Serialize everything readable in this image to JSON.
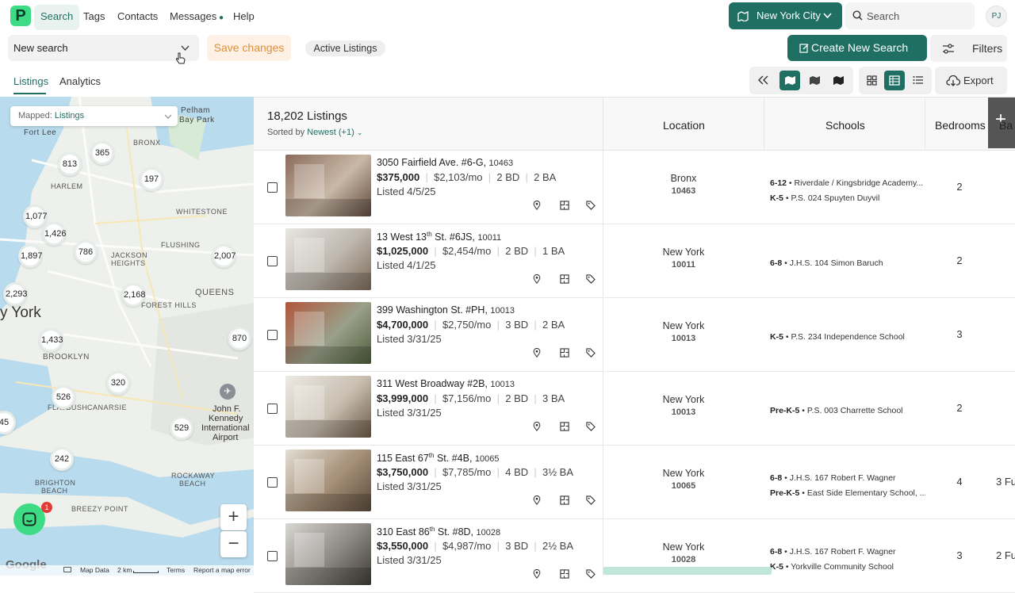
{
  "nav": {
    "logo": "P",
    "items": [
      {
        "label": "Search"
      },
      {
        "label": "Tags"
      },
      {
        "label": "Contacts"
      },
      {
        "label": "Messages"
      },
      {
        "label": "Help"
      }
    ],
    "city": "New York City",
    "search_placeholder": "Search",
    "avatar": "PJ"
  },
  "toolbar": {
    "new_search": "New search",
    "save": "Save changes",
    "active_chip": "Active Listings",
    "create": "Create New Search",
    "filters": "Filters",
    "export": "Export"
  },
  "tabs": [
    {
      "label": "Listings"
    },
    {
      "label": "Analytics"
    }
  ],
  "map": {
    "mapped_prefix": "Mapped:",
    "mapped_value": "Listings",
    "clusters": [
      "813",
      "365",
      "197",
      "1,077",
      "1,426",
      "1,897",
      "786",
      "2,007",
      "2,293",
      "2,168",
      "1,433",
      "870",
      "526",
      "320",
      "45",
      "529",
      "242"
    ],
    "labels": [
      "Pelham",
      "Bay Park",
      "Fort Lee",
      "BRONX",
      "HARLEM",
      "WHITESTONE",
      "JACKSON",
      "HEIGHTS",
      "FLUSHING",
      "QUEENS",
      "FOREST HILLS",
      "y York",
      "BROOKLYN",
      "CANARSIE",
      "FLATBUSH",
      "John F.",
      "Kennedy",
      "International",
      "Airport",
      "BRIGHTON",
      "BEACH",
      "ROCKAWAY",
      "BEACH",
      "BREEZY POINT"
    ],
    "footer": {
      "google": "Google",
      "data": "Map Data",
      "scale": "2 km",
      "terms": "Terms",
      "report": "Report a map error"
    },
    "chat_badge": "1"
  },
  "list": {
    "count": "18,202 Listings",
    "sort_label": "Sorted by",
    "sort_value": "Newest (+1)",
    "columns": [
      "Location",
      "Schools",
      "Bedrooms",
      "Ba"
    ],
    "rows": [
      {
        "address": "3050 Fairfield Ave. #6-G,",
        "sup": "",
        "zip": "10463",
        "price": "$375,000",
        "monthly": "$2,103/mo",
        "bd": "2 BD",
        "ba": "2 BA",
        "listed": "Listed 4/5/25",
        "loc": "Bronx",
        "loc_zip": "10463",
        "schools": [
          {
            "grade": "6-12",
            "name": "Riverdale / Kingsbridge Academy..."
          },
          {
            "grade": "K-5",
            "name": "P.S. 024 Spuyten Duyvil"
          }
        ],
        "beds": "2",
        "baths": ""
      },
      {
        "address": "13 West 13",
        "sup": "th",
        "address2": " St. #6JS,",
        "zip": "10011",
        "price": "$1,025,000",
        "monthly": "$2,454/mo",
        "bd": "2 BD",
        "ba": "1 BA",
        "listed": "Listed 4/1/25",
        "loc": "New York",
        "loc_zip": "10011",
        "schools": [
          {
            "grade": "6-8",
            "name": "J.H.S. 104 Simon Baruch"
          }
        ],
        "beds": "2",
        "baths": ""
      },
      {
        "address": "399 Washington St. #PH,",
        "sup": "",
        "zip": "10013",
        "price": "$4,700,000",
        "monthly": "$2,750/mo",
        "bd": "3 BD",
        "ba": "2 BA",
        "listed": "Listed 3/31/25",
        "loc": "New York",
        "loc_zip": "10013",
        "schools": [
          {
            "grade": "K-5",
            "name": "P.S. 234 Independence School"
          }
        ],
        "beds": "3",
        "baths": ""
      },
      {
        "address": "311 West Broadway #2B,",
        "sup": "",
        "zip": "10013",
        "price": "$3,999,000",
        "monthly": "$7,156/mo",
        "bd": "2 BD",
        "ba": "3 BA",
        "listed": "Listed 3/31/25",
        "loc": "New York",
        "loc_zip": "10013",
        "schools": [
          {
            "grade": "Pre-K-5",
            "name": "P.S. 003 Charrette School"
          }
        ],
        "beds": "2",
        "baths": ""
      },
      {
        "address": "115 East 67",
        "sup": "th",
        "address2": " St. #4B,",
        "zip": "10065",
        "price": "$3,750,000",
        "monthly": "$7,785/mo",
        "bd": "4 BD",
        "ba": "3½ BA",
        "listed": "Listed 3/31/25",
        "loc": "New York",
        "loc_zip": "10065",
        "schools": [
          {
            "grade": "6-8",
            "name": "J.H.S. 167 Robert F. Wagner"
          },
          {
            "grade": "Pre-K-5",
            "name": "East Side Elementary School, ..."
          }
        ],
        "beds": "4",
        "baths": "3 Fu"
      },
      {
        "address": "310 East 86",
        "sup": "th",
        "address2": " St. #8D,",
        "zip": "10028",
        "price": "$3,550,000",
        "monthly": "$4,987/mo",
        "bd": "3 BD",
        "ba": "2½ BA",
        "listed": "Listed 3/31/25",
        "loc": "New York",
        "loc_zip": "10028",
        "schools": [
          {
            "grade": "6-8",
            "name": "J.H.S. 167 Robert F. Wagner"
          },
          {
            "grade": "K-5",
            "name": "Yorkville Community School"
          }
        ],
        "beds": "3",
        "baths": "2 Fu"
      }
    ]
  },
  "colors": {
    "brand": "#1f6f63",
    "accent_green": "#3ddc84",
    "save_orange": "#e0903a"
  }
}
